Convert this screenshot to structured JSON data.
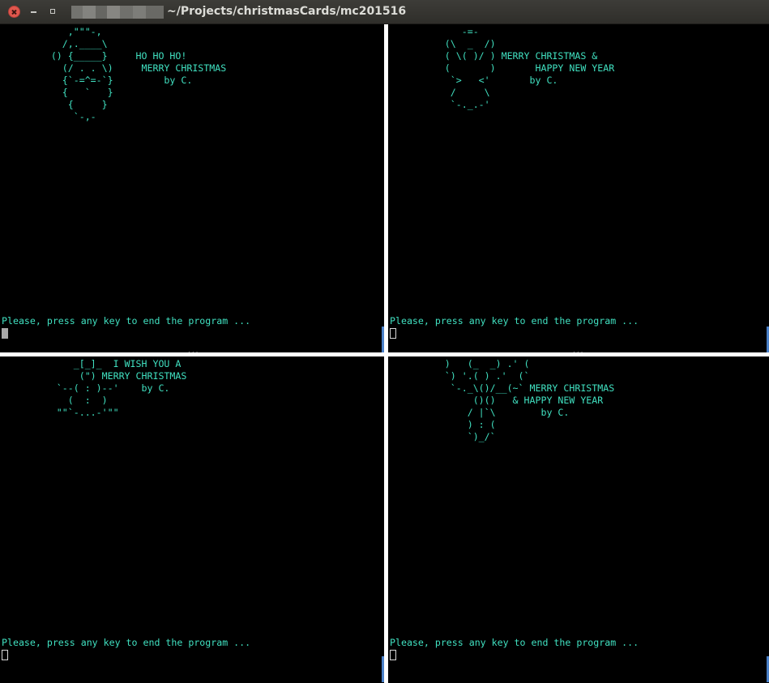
{
  "window": {
    "title": "~/Projects/christmasCards/mc201516"
  },
  "panes": [
    {
      "art": [
        "            ,\"\"\"-,",
        "           /,.____\\",
        "         () {_____}     HO HO HO!",
        "           (/ . . \\)     MERRY CHRISTMAS",
        "           {`-=^=-`}         by C.",
        "           {   `   }",
        "            {     }",
        "             `-,-"
      ],
      "prompt": "Please, press any key to end the program ...",
      "cursor": "filled"
    },
    {
      "art": [
        "             -=-",
        "          (\\  _  /)",
        "          ( \\( )/ ) MERRY CHRISTMAS &",
        "          (       )       HAPPY NEW YEAR",
        "           `>   <'       by C.",
        "           /     \\",
        "           `-._.-'"
      ],
      "prompt": "Please, press any key to end the program ...",
      "cursor": "hollow"
    },
    {
      "art": [
        "             _[_]_  I WISH YOU A",
        "              (\") MERRY CHRISTMAS",
        "          `--( : )--'    by C.",
        "            (  :  )",
        "          \"\"`-...-'\"\""
      ],
      "prompt": "Please, press any key to end the program ...",
      "cursor": "hollow"
    },
    {
      "art": [
        "          )   (_  _) .' (",
        "          `) '.( ) .'  (`",
        "           `-._\\()/__(~` MERRY CHRISTMAS",
        "               ()()   & HAPPY NEW YEAR",
        "              / |`\\        by C.",
        "              ) : (",
        "              `)_/`"
      ],
      "prompt": "Please, press any key to end the program ...",
      "cursor": "hollow"
    }
  ]
}
